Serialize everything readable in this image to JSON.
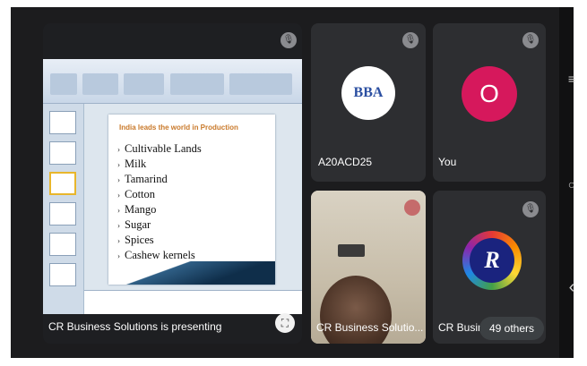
{
  "presenter": {
    "caption": "CR Business Solutions is presenting",
    "slide": {
      "title": "India leads the world in Production",
      "items": [
        "Cultivable Lands",
        "Milk",
        "Tamarind",
        "Cotton",
        "Mango",
        "Sugar",
        "Spices",
        "Cashew kernels"
      ],
      "bullet": "›"
    }
  },
  "participants": [
    {
      "name": "A20ACD25",
      "avatar_text": "BBA"
    },
    {
      "name": "You",
      "avatar_text": "O"
    },
    {
      "name": "CR Business Solutio..."
    },
    {
      "name": "CR Busin"
    }
  ],
  "others_label": "49 others",
  "icons": {
    "mic_off": "🎙",
    "fullscreen": "⛶",
    "menu": "≡",
    "home": "○",
    "back": "‹"
  },
  "colors": {
    "you_avatar": "#d6185c",
    "tile_bg": "#2d2e31"
  }
}
